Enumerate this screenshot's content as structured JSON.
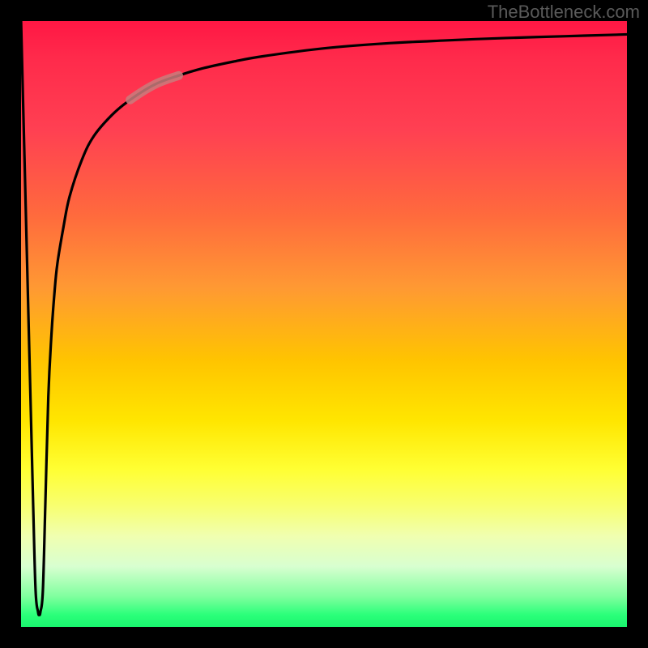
{
  "attribution": "TheBottleneck.com",
  "colors": {
    "background": "#000000",
    "attribution_text": "#5a5a5a",
    "curve": "#000000",
    "highlight_segment": "#c97d7d"
  },
  "chart_data": {
    "type": "line",
    "title": "",
    "xlabel": "",
    "ylabel": "",
    "xlim": [
      0,
      100
    ],
    "ylim": [
      0,
      100
    ],
    "grid": false,
    "series": [
      {
        "name": "bottleneck-curve",
        "x": [
          0.0,
          1.0,
          2.0,
          2.4,
          2.8,
          3.0,
          3.2,
          3.6,
          4.0,
          4.5,
          5.0,
          5.5,
          6.0,
          7.0,
          8.0,
          10.0,
          12.0,
          15.0,
          18.0,
          22.0,
          26.0,
          30.0,
          35.0,
          40.0,
          50.0,
          60.0,
          70.0,
          80.0,
          90.0,
          100.0
        ],
        "values": [
          100.0,
          60.0,
          20.0,
          6.0,
          2.5,
          2.0,
          2.5,
          6.0,
          20.0,
          38.0,
          48.0,
          55.0,
          60.0,
          66.0,
          71.0,
          77.0,
          81.0,
          84.5,
          87.0,
          89.5,
          91.0,
          92.2,
          93.3,
          94.2,
          95.5,
          96.3,
          96.8,
          97.2,
          97.5,
          97.8
        ]
      }
    ],
    "highlighted_segment": {
      "series": "bottleneck-curve",
      "x_start": 18.0,
      "x_end": 26.0
    },
    "gradient_background": {
      "orientation": "vertical",
      "stops": [
        {
          "pos": 0.0,
          "color": "#ff1744"
        },
        {
          "pos": 0.5,
          "color": "#ffc400"
        },
        {
          "pos": 0.76,
          "color": "#ffff33"
        },
        {
          "pos": 1.0,
          "color": "#19f56e"
        }
      ]
    }
  }
}
